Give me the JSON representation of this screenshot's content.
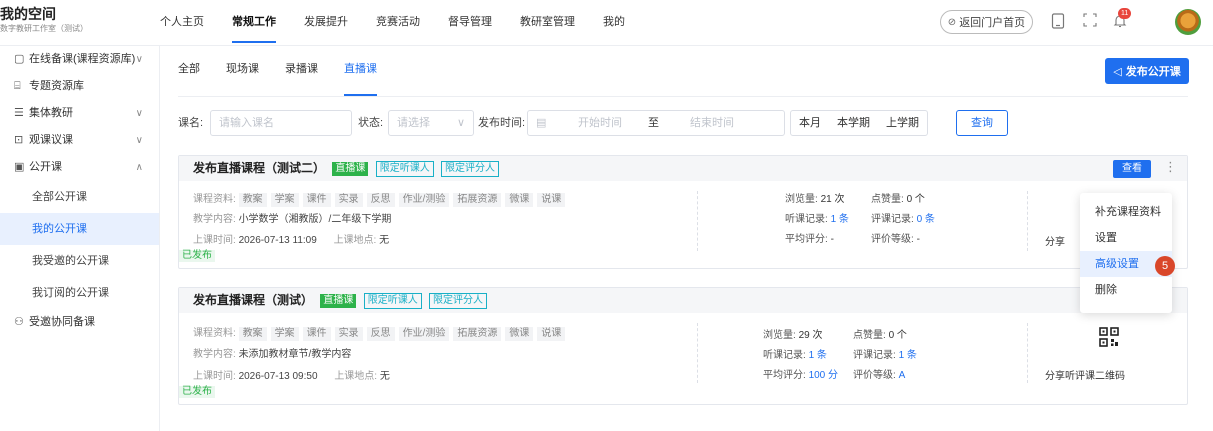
{
  "brand": {
    "title": "我的空间",
    "subtitle": "数字教研工作室（测试）"
  },
  "topnav": [
    "个人主页",
    "常规工作",
    "发展提升",
    "竞赛活动",
    "督导管理",
    "教研室管理",
    "我的"
  ],
  "topnav_active": "常规工作",
  "header": {
    "home_button": "返回门户首页",
    "notification_count": "11"
  },
  "sidebar": {
    "items": [
      {
        "label": "在线备课(课程资源库)",
        "icon": "document-icon",
        "chevron": "down"
      },
      {
        "label": "专题资源库",
        "icon": "folder-icon",
        "chevron": ""
      },
      {
        "label": "集体教研",
        "icon": "list-icon",
        "chevron": "down"
      },
      {
        "label": "观课议课",
        "icon": "chat-icon",
        "chevron": "down"
      },
      {
        "label": "公开课",
        "icon": "presentation-icon",
        "chevron": "up"
      }
    ],
    "sub_items": [
      "全部公开课",
      "我的公开课",
      "我受邀的公开课",
      "我订阅的公开课"
    ],
    "active_sub": "我的公开课",
    "last_item": {
      "label": "受邀协同备课",
      "icon": "people-icon"
    }
  },
  "tabs": [
    "全部",
    "现场课",
    "录播课",
    "直播课"
  ],
  "active_tab": "直播课",
  "publish_button": "发布公开课",
  "filter": {
    "course_label": "课名:",
    "course_placeholder": "请输入课名",
    "status_label": "状态:",
    "status_placeholder": "请选择",
    "time_label": "发布时间:",
    "start_placeholder": "开始时间",
    "to_label": "至",
    "end_placeholder": "结束时间",
    "chips": [
      "本月",
      "本学期",
      "上学期"
    ],
    "query_button": "查询"
  },
  "cards": [
    {
      "title": "发布直播课程（测试二）",
      "tags": [
        "直播课",
        "限定听课人",
        "限定评分人"
      ],
      "view_label": "查看",
      "materials_label": "课程资料:",
      "materials": [
        "教案",
        "学案",
        "课件",
        "实录",
        "反思",
        "作业/测验",
        "拓展资源",
        "微课",
        "说课"
      ],
      "content_label": "教学内容:",
      "content": "小学数学（湘教版）/二年级下学期",
      "time_label": "上课时间:",
      "time": "2026-07-13 11:09",
      "place_label": "上课地点:",
      "place": "无",
      "status": "已发布",
      "views_label": "浏览量:",
      "views": "21 次",
      "likes_label": "点赞量:",
      "likes": "0 个",
      "listen_label": "听课记录:",
      "listen": "1 条",
      "review_label": "评课记录:",
      "review": "0 条",
      "score_label": "平均评分:",
      "score": "-",
      "grade_label": "评价等级:",
      "grade": "-",
      "share_label": "分享"
    },
    {
      "title": "发布直播课程（测试）",
      "tags": [
        "直播课",
        "限定听课人",
        "限定评分人"
      ],
      "materials_label": "课程资料:",
      "materials": [
        "教案",
        "学案",
        "课件",
        "实录",
        "反思",
        "作业/测验",
        "拓展资源",
        "微课",
        "说课"
      ],
      "content_label": "教学内容:",
      "content": "未添加教材章节/教学内容",
      "time_label": "上课时间:",
      "time": "2026-07-13 09:50",
      "place_label": "上课地点:",
      "place": "无",
      "status": "已发布",
      "views_label": "浏览量:",
      "views": "29 次",
      "likes_label": "点赞量:",
      "likes": "0 个",
      "listen_label": "听课记录:",
      "listen": "1 条",
      "review_label": "评课记录:",
      "review": "1 条",
      "score_label": "平均评分:",
      "score": "100 分",
      "grade_label": "评价等级:",
      "grade": "A",
      "share_label": "分享听评课二维码"
    }
  ],
  "dropdown_menu": {
    "items": [
      "补充课程资料",
      "设置",
      "高级设置",
      "删除"
    ],
    "highlighted": "高级设置",
    "badge": "5"
  },
  "colors": {
    "primary": "#1f6fef",
    "live_tag": "#2db24a",
    "outline_tag": "#19b0c7",
    "badge": "#d9472a"
  }
}
